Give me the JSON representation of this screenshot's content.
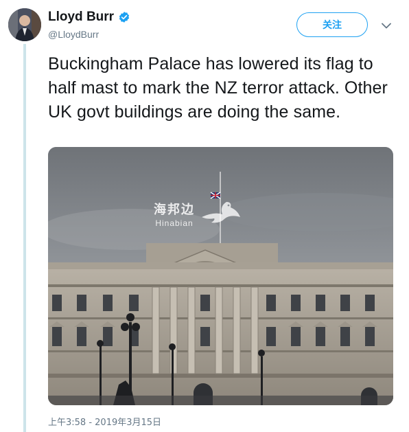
{
  "author": {
    "display_name": "Lloyd Burr",
    "handle": "@LloydBurr",
    "verified_icon": "verified-badge-icon"
  },
  "actions": {
    "follow_label": "关注",
    "more_icon": "chevron-down-icon"
  },
  "tweet": {
    "text": "Buckingham Palace has lowered its flag to half mast to mark the NZ terror attack. Other UK govt buildings are doing the same.",
    "timestamp": "上午3:58 - 2019年3月15日"
  },
  "media": {
    "alt": "Buckingham Palace facade with Union flag at half mast",
    "watermark_cn": "海邦边",
    "watermark_en": "Hinabian"
  },
  "colors": {
    "accent": "#1da1f2",
    "secondary_text": "#657786",
    "thread_line": "#cde4ea"
  }
}
